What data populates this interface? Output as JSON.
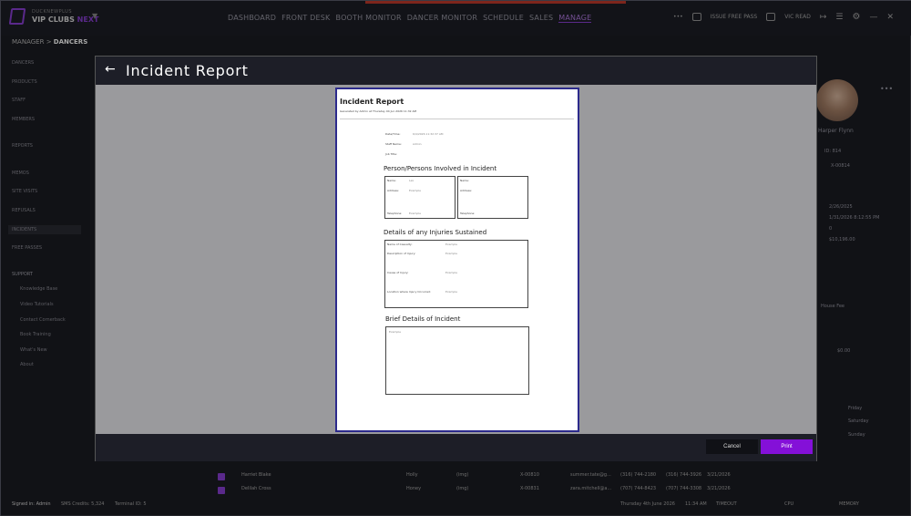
{
  "app": {
    "tagline": "DUCKNEWPLUS",
    "name": "VIP CLUBS",
    "name_suffix": "NEXT"
  },
  "nav": [
    "DASHBOARD",
    "FRONT DESK",
    "BOOTH MONITOR",
    "DANCER MONITOR",
    "SCHEDULE",
    "SALES",
    "MANAGE"
  ],
  "nav_active": "MANAGE",
  "toolbar": {
    "issue_free_pass": "ISSUE FREE PASS",
    "vic_read": "VIC READ"
  },
  "breadcrumb": {
    "parent": "MANAGER",
    "sep": ">",
    "current": "DANCERS"
  },
  "sidebar": {
    "items": [
      "DANCERS",
      "PRODUCTS",
      "STAFF",
      "MEMBERS",
      "REPORTS",
      "MEMOS",
      "SITE VISITS",
      "REFUSALS",
      "INCIDENTS",
      "FREE PASSES"
    ],
    "selected": "INCIDENTS",
    "support_header": "SUPPORT",
    "support_items": [
      "Knowledge Base",
      "Video Tutorials",
      "Contact Cornerback",
      "Book Training",
      "What's New",
      "About"
    ]
  },
  "profile": {
    "name": "Harper Flynn",
    "id": "ID: 814",
    "ext": "X-00814",
    "date1": "2/26/2025",
    "date2": "1/31/2026 8:12:55 PM",
    "val1": "0",
    "val2": "$10,196.00",
    "house_fee": "House Fee",
    "amount": "$0.00",
    "days": [
      "Friday",
      "Saturday",
      "Sunday"
    ]
  },
  "bg_rows": [
    {
      "name": "Harriet Blake",
      "stage": "Holly",
      "tag": "(img)",
      "code": "X-00810",
      "email": "summer.tate@g...",
      "phone1": "(316) 744-2180",
      "phone2": "(316) 744-3926",
      "date": "3/21/2026"
    },
    {
      "name": "Delilah Cross",
      "stage": "Honey",
      "tag": "(img)",
      "code": "X-00831",
      "email": "zara.mitchell@a...",
      "phone1": "(707) 744-8423",
      "phone2": "(707) 744-3308",
      "date": "3/21/2026"
    }
  ],
  "status": {
    "signed_in": "Signed in: Admin",
    "sms": "SMS Credits: 5,324",
    "terminal": "Terminal ID: 5",
    "datetime": "Thursday 4th June 2026",
    "time": "11:34 AM",
    "timeout": "TIMEOUT",
    "cpu": "CPU",
    "memory": "MEMORY"
  },
  "modal": {
    "title": "Incident  Report",
    "cancel": "Cancel",
    "print": "Print",
    "doc": {
      "title": "Incident Report",
      "generated": "Generated by Admin at Thursday 04 Jun 2026 11:32 AM",
      "fields": [
        {
          "label": "Date/Time:",
          "value": "6/4/2026 11:32:37 AM"
        },
        {
          "label": "Staff Name:",
          "value": "Admin"
        },
        {
          "label": "Job Title:",
          "value": ""
        }
      ],
      "sec_persons": "Person/Persons Involved in Incident",
      "person_fields": [
        "Name:",
        "Address:",
        "Telephone:"
      ],
      "person1": {
        "name": "Lex",
        "address": "Example",
        "telephone": "Example"
      },
      "sec_injuries": "Details of any Injuries Sustained",
      "injury_fields": [
        {
          "label": "Name of Casualty:",
          "value": "Example"
        },
        {
          "label": "Description of Injury:",
          "value": "Example"
        },
        {
          "label": "Cause of Injury:",
          "value": "Example"
        },
        {
          "label": "Location where Injury Occurred:",
          "value": "Example"
        }
      ],
      "sec_brief": "Brief Details of Incident",
      "brief_value": "Example"
    }
  }
}
